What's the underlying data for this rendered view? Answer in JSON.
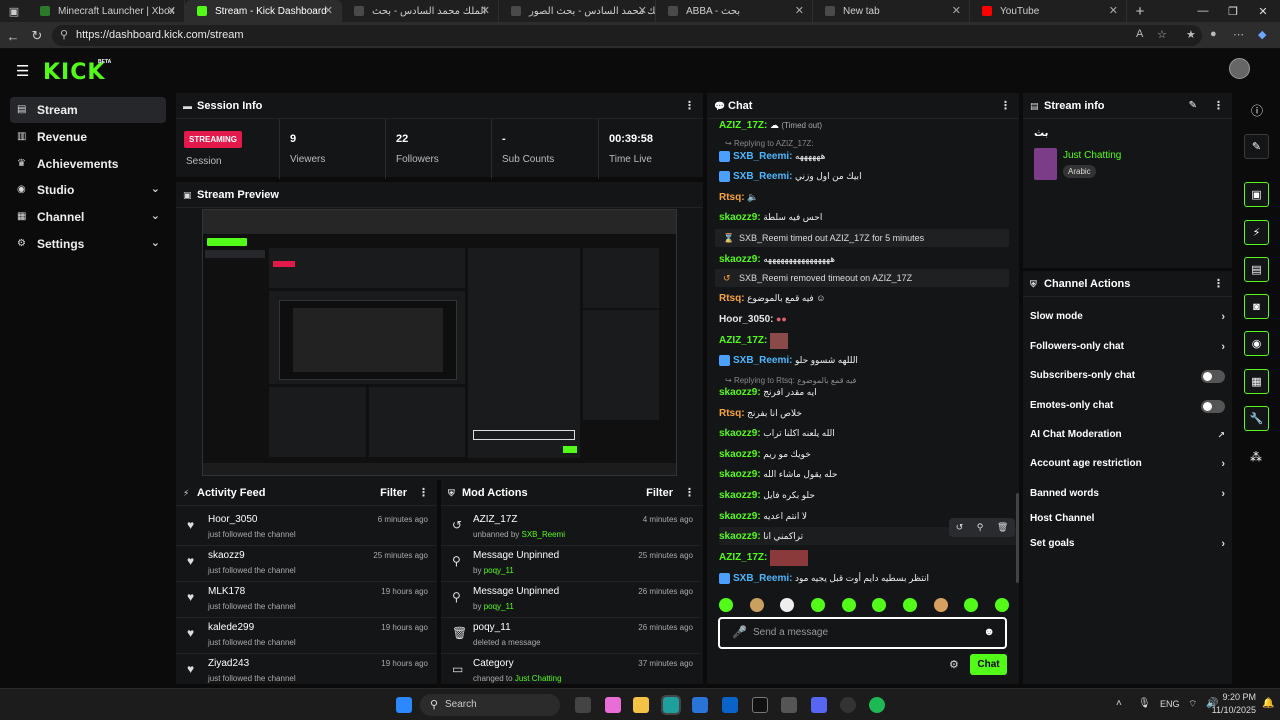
{
  "browser": {
    "tabs": [
      {
        "label": "Minecraft Launcher | Xbox",
        "color": "#2a7a2a"
      },
      {
        "label": "Stream - Kick Dashboard",
        "color": "#53fc18"
      },
      {
        "label": "الملك محمد السادس - بحث",
        "color": "#4a4a4a"
      },
      {
        "label": "الملك محمد السادس - بحث الصور",
        "color": "#4a4a4a"
      },
      {
        "label": "ABBA - بحث",
        "color": "#4a4a4a"
      },
      {
        "label": "New tab",
        "color": "#4a4a4a"
      },
      {
        "label": "YouTube",
        "color": "#ff0000"
      }
    ],
    "url": "https://dashboard.kick.com/stream"
  },
  "header": {
    "logo": "KICK",
    "beta": "BETA"
  },
  "sidebar": {
    "items": [
      {
        "label": "Stream",
        "icon": "stream-icon"
      },
      {
        "label": "Revenue",
        "icon": "revenue-icon"
      },
      {
        "label": "Achievements",
        "icon": "trophy-icon"
      },
      {
        "label": "Studio",
        "icon": "studio-icon"
      },
      {
        "label": "Channel",
        "icon": "channel-icon"
      },
      {
        "label": "Settings",
        "icon": "gear-icon"
      }
    ]
  },
  "session": {
    "title": "Session Info",
    "status": "STREAMING",
    "status_label": "Session",
    "stats": [
      {
        "value": "9",
        "label": "Viewers"
      },
      {
        "value": "22",
        "label": "Followers"
      },
      {
        "value": "-",
        "label": "Sub Counts"
      },
      {
        "value": "00:39:58",
        "label": "Time Live"
      }
    ]
  },
  "preview": {
    "title": "Stream Preview"
  },
  "activity": {
    "title": "Activity Feed",
    "filter": "Filter",
    "rows": [
      {
        "name": "Hoor_3050",
        "sub": "just followed the channel",
        "time": "6 minutes ago"
      },
      {
        "name": "skaozz9",
        "sub": "just followed the channel",
        "time": "25 minutes ago"
      },
      {
        "name": "MLK178",
        "sub": "just followed the channel",
        "time": "19 hours ago"
      },
      {
        "name": "kalede299",
        "sub": "just followed the channel",
        "time": "19 hours ago"
      },
      {
        "name": "Ziyad243",
        "sub": "just followed the channel",
        "time": "19 hours ago"
      }
    ]
  },
  "mod": {
    "title": "Mod Actions",
    "filter": "Filter",
    "rows": [
      {
        "name": "AZIZ_17Z",
        "sub": "unbanned by",
        "by": "SXB_Reemi",
        "time": "4 minutes ago"
      },
      {
        "name": "Message Unpinned",
        "sub": "by",
        "by": "poqy_11",
        "time": "25 minutes ago"
      },
      {
        "name": "Message Unpinned",
        "sub": "by",
        "by": "poqy_11",
        "time": "26 minutes ago"
      },
      {
        "name": "poqy_11",
        "sub": "deleted a message",
        "by": "",
        "time": "26 minutes ago"
      },
      {
        "name": "Category",
        "sub": "changed to",
        "by": "Just Chatting",
        "time": "37 minutes ago"
      }
    ]
  },
  "chat": {
    "title": "Chat",
    "timed_out_note": "(Timed out)",
    "reply_to_aziz": "Replying to AZIZ_17Z:",
    "reply_to_rtsq": "Replying to Rtsq: فيه قمع بالموضوع",
    "sys1": {
      "user": "SXB_Reemi",
      "mid": "timed out",
      "target": "AZIZ_17Z",
      "end": "for 5 minutes"
    },
    "sys2": {
      "user": "SXB_Reemi",
      "mid": "removed timeout on",
      "target": "AZIZ_17Z"
    },
    "messages": [
      {
        "user": "AZIZ_17Z",
        "text": ""
      },
      {
        "user": "SXB_Reemi",
        "text": "ههههههه"
      },
      {
        "user": "SXB_Reemi",
        "text": "ابيك من اول وزني"
      },
      {
        "user": "Rtsq",
        "text": ""
      },
      {
        "user": "skaozz9",
        "text": "احس فيه سلطة"
      },
      {
        "user": "skaozz9",
        "text": "ههههههههههههههههه"
      },
      {
        "user": "Rtsq",
        "text": "فيه قمع بالموضوع"
      },
      {
        "user": "Hoor_3050",
        "text": ""
      },
      {
        "user": "AZIZ_17Z",
        "text": ""
      },
      {
        "user": "SXB_Reemi",
        "text": "الللهه شسوو حلو"
      },
      {
        "user": "skaozz9",
        "text": "ايه مقدر افرنج"
      },
      {
        "user": "Rtsq",
        "text": "خلاص انا بفرنج"
      },
      {
        "user": "skaozz9",
        "text": "الله يلعنه اكلنا تراب"
      },
      {
        "user": "skaozz9",
        "text": "خويك مو ريم"
      },
      {
        "user": "skaozz9",
        "text": "حله يقول ماشاء الله"
      },
      {
        "user": "skaozz9",
        "text": "حلو بكره فايل"
      },
      {
        "user": "skaozz9",
        "text": "لا انتم اعديه"
      },
      {
        "user": "skaozz9",
        "text": "تراكمني انا"
      },
      {
        "user": "AZIZ_17Z",
        "text": ""
      },
      {
        "user": "SXB_Reemi",
        "text": "انتظر بسطيه دايم أوت قبل يجيه مود"
      }
    ],
    "placeholder": "Send a message",
    "send": "Chat"
  },
  "stream_info": {
    "title": "Stream info",
    "stream_title": "بث",
    "category": "Just Chatting",
    "language": "Arabic"
  },
  "channel_actions": {
    "title": "Channel Actions",
    "items": [
      {
        "label": "Slow mode"
      },
      {
        "label": "Followers-only chat"
      },
      {
        "label": "Subscribers-only chat"
      },
      {
        "label": "Emotes-only chat"
      },
      {
        "label": "AI Chat Moderation"
      },
      {
        "label": "Account age restriction"
      },
      {
        "label": "Banned words"
      },
      {
        "label": "Host Channel"
      },
      {
        "label": "Set goals"
      }
    ]
  },
  "taskbar": {
    "search": "Search",
    "lang": "ENG",
    "time": "9:20 PM",
    "date": "11/10/2025"
  }
}
